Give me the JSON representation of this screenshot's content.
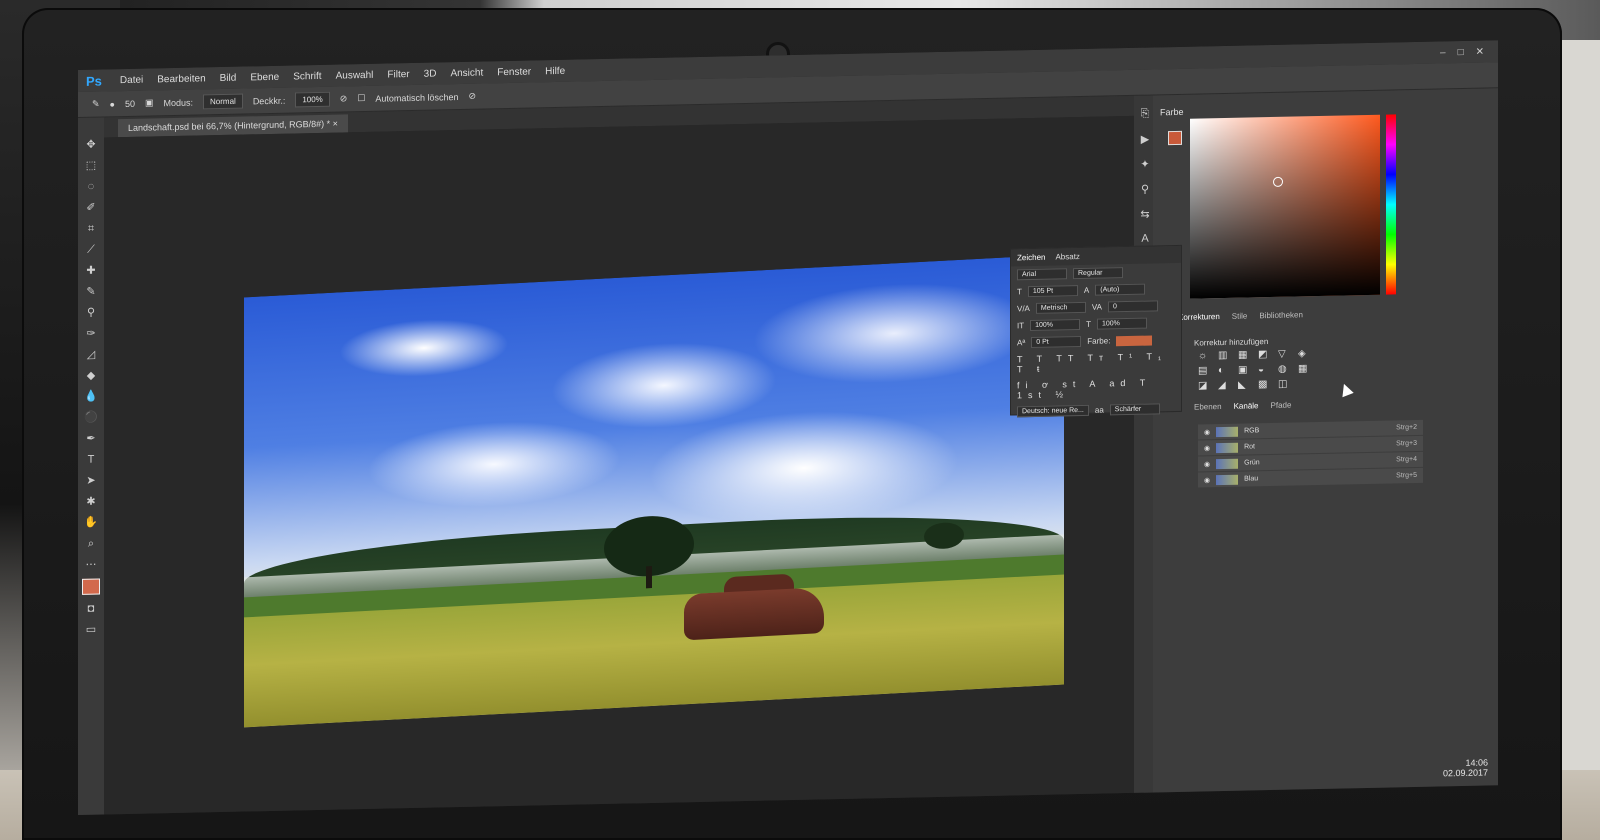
{
  "app": {
    "logo": "Ps",
    "menu": [
      "Datei",
      "Bearbeiten",
      "Bild",
      "Ebene",
      "Schrift",
      "Auswahl",
      "Filter",
      "3D",
      "Ansicht",
      "Fenster",
      "Hilfe"
    ],
    "window_controls": [
      "–",
      "□",
      "✕"
    ]
  },
  "options_bar": {
    "brush_size": "50",
    "mode_label": "Modus:",
    "mode_value": "Normal",
    "opacity_label": "Deckkr.:",
    "opacity_value": "100%",
    "auto_erase_label": "Automatisch löschen"
  },
  "document_tab": {
    "title": "Landschaft.psd bei 66,7% (Hintergrund, RGB/8#) *",
    "close": "×"
  },
  "color_panel": {
    "title": "Farbe",
    "fg_color": "#c95a3a"
  },
  "adjustments_panel": {
    "tabs": [
      "Korrekturen",
      "Stile",
      "Bibliotheken"
    ],
    "label": "Korrektur hinzufügen",
    "icons": [
      "☼",
      "▥",
      "▦",
      "◩",
      "▽",
      "◈",
      "▤",
      "◐",
      "▣",
      "◒",
      "◍",
      "▦",
      "◪",
      "◢",
      "◣",
      "▩",
      "◫"
    ]
  },
  "channels_panel": {
    "tabs": [
      "Ebenen",
      "Kanäle",
      "Pfade"
    ],
    "rows": [
      {
        "name": "RGB",
        "shortcut": "Strg+2"
      },
      {
        "name": "Rot",
        "shortcut": "Strg+3"
      },
      {
        "name": "Grün",
        "shortcut": "Strg+4"
      },
      {
        "name": "Blau",
        "shortcut": "Strg+5"
      }
    ]
  },
  "character_panel": {
    "tabs": [
      "Zeichen",
      "Absatz"
    ],
    "font_family": "Arial",
    "font_style": "Regular",
    "font_size": "105 Pt",
    "leading": "(Auto)",
    "kerning": "Metrisch",
    "tracking": "0",
    "vertical_scale": "100%",
    "horizontal_scale": "100%",
    "baseline_shift": "0 Pt",
    "color_label": "Farbe:",
    "style_glyphs": "T T TT Tт T¹ T₁ T ŧ",
    "ot_glyphs": "fi ơ st A ad T 1st ½",
    "language": "Deutsch: neue Re...",
    "antialias": "Schärfer"
  },
  "system_tray": {
    "time": "14:06",
    "date": "02.09.2017"
  }
}
